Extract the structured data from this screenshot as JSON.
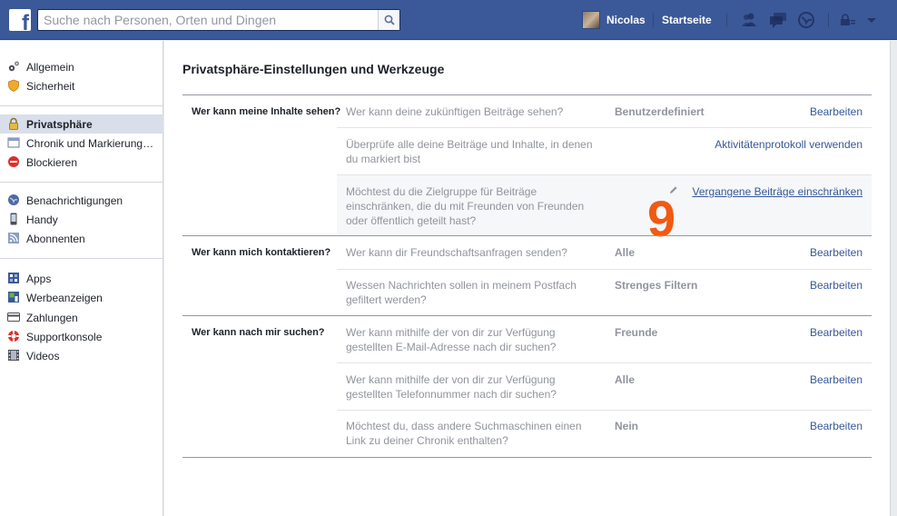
{
  "topbar": {
    "search_placeholder": "Suche nach Personen, Orten und Dingen",
    "user_name": "Nicolas",
    "home_label": "Startseite",
    "bg_color": "#3b5998"
  },
  "sidebar": {
    "items": [
      {
        "label": "Allgemein",
        "icon": "gears-icon"
      },
      {
        "label": "Sicherheit",
        "icon": "shield-icon"
      },
      {
        "label": "Privatsphäre",
        "icon": "lock-icon",
        "active": true
      },
      {
        "label": "Chronik und Markierung…",
        "icon": "timeline-icon"
      },
      {
        "label": "Blockieren",
        "icon": "block-icon"
      },
      {
        "label": "Benachrichtigungen",
        "icon": "globe-icon"
      },
      {
        "label": "Handy",
        "icon": "phone-icon"
      },
      {
        "label": "Abonnenten",
        "icon": "rss-icon"
      },
      {
        "label": "Apps",
        "icon": "apps-icon"
      },
      {
        "label": "Werbeanzeigen",
        "icon": "ads-icon"
      },
      {
        "label": "Zahlungen",
        "icon": "credit-card-icon"
      },
      {
        "label": "Supportkonsole",
        "icon": "lifebuoy-icon"
      },
      {
        "label": "Videos",
        "icon": "film-icon"
      }
    ]
  },
  "main": {
    "title": "Privatsphäre-Einstellungen und Werkzeuge",
    "sections": [
      {
        "label": "Wer kann meine Inhalte sehen?",
        "rows": [
          {
            "question": "Wer kann deine zukünftigen Beiträge sehen?",
            "value": "Benutzerdefiniert",
            "action": "Bearbeiten"
          },
          {
            "question": "Überprüfe alle deine Beiträge und Inhalte, in denen du markiert bist",
            "value": "",
            "action": "Aktivitätenprotokoll verwenden"
          },
          {
            "question": "Möchtest du die Zielgruppe für Beiträge einschränken, die du mit Freunden von Freunden oder öffentlich geteilt hast?",
            "value": "",
            "action": "Vergangene Beiträge einschränken"
          }
        ]
      },
      {
        "label": "Wer kann mich kontaktieren?",
        "rows": [
          {
            "question": "Wer kann dir Freundschaftsanfragen senden?",
            "value": "Alle",
            "action": "Bearbeiten"
          },
          {
            "question": "Wessen Nachrichten sollen in meinem Postfach gefiltert werden?",
            "value": "Strenges Filtern",
            "action": "Bearbeiten"
          }
        ]
      },
      {
        "label": "Wer kann nach mir suchen?",
        "rows": [
          {
            "question": "Wer kann mithilfe der von dir zur Verfügung gestellten E-Mail-Adresse nach dir suchen?",
            "value": "Freunde",
            "action": "Bearbeiten"
          },
          {
            "question": "Wer kann mithilfe der von dir zur Verfügung gestellten Telefonnummer nach dir suchen?",
            "value": "Alle",
            "action": "Bearbeiten"
          },
          {
            "question": "Möchtest du, dass andere Suchmaschinen einen Link zu deiner Chronik enthalten?",
            "value": "Nein",
            "action": "Bearbeiten"
          }
        ]
      }
    ],
    "annotation_number": "9"
  }
}
